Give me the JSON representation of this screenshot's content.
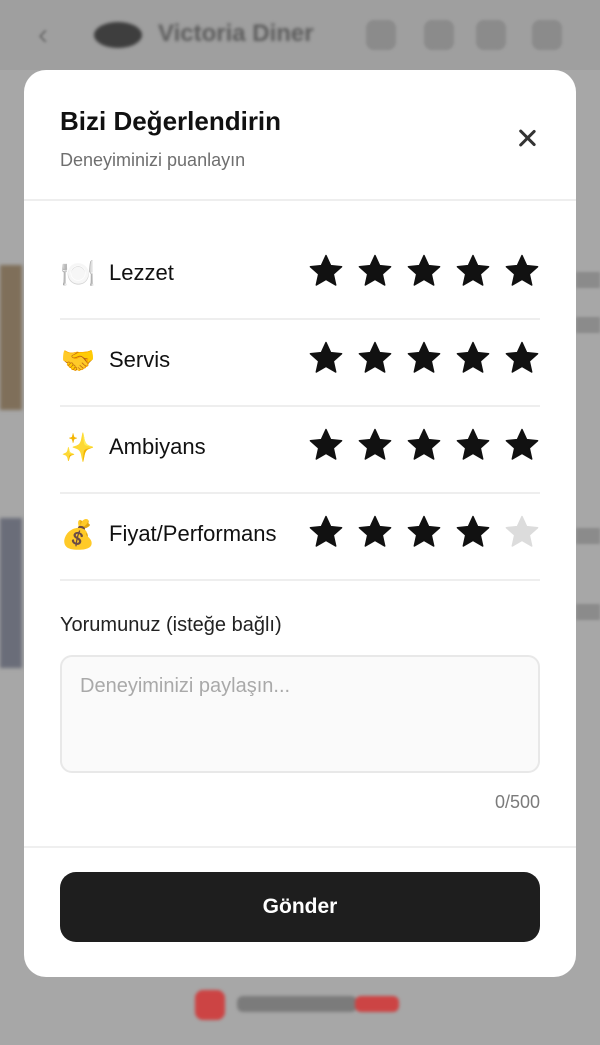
{
  "background": {
    "app_title": "Victoria Diner"
  },
  "modal": {
    "title": "Bizi Değerlendirin",
    "subtitle": "Deneyiminizi puanlayın",
    "ratings": [
      {
        "icon": "plate-icon",
        "emoji": "🍽️",
        "label": "Lezzet",
        "stars": 5
      },
      {
        "icon": "handshake-icon",
        "emoji": "🤝",
        "label": "Servis",
        "stars": 5
      },
      {
        "icon": "sparkles-icon",
        "emoji": "✨",
        "label": "Ambiyans",
        "stars": 5
      },
      {
        "icon": "money-bag-icon",
        "emoji": "💰",
        "label": "Fiyat/Performans",
        "stars": 4
      }
    ],
    "max_stars": 5,
    "comment": {
      "label": "Yorumunuz (isteğe bağlı)",
      "placeholder": "Deneyiminizi paylaşın...",
      "value": "",
      "counter": "0/500"
    },
    "submit_label": "Gönder"
  },
  "colors": {
    "star_filled": "#111111",
    "star_empty": "#dcdcdc",
    "submit_bg": "#1e1e1e"
  }
}
